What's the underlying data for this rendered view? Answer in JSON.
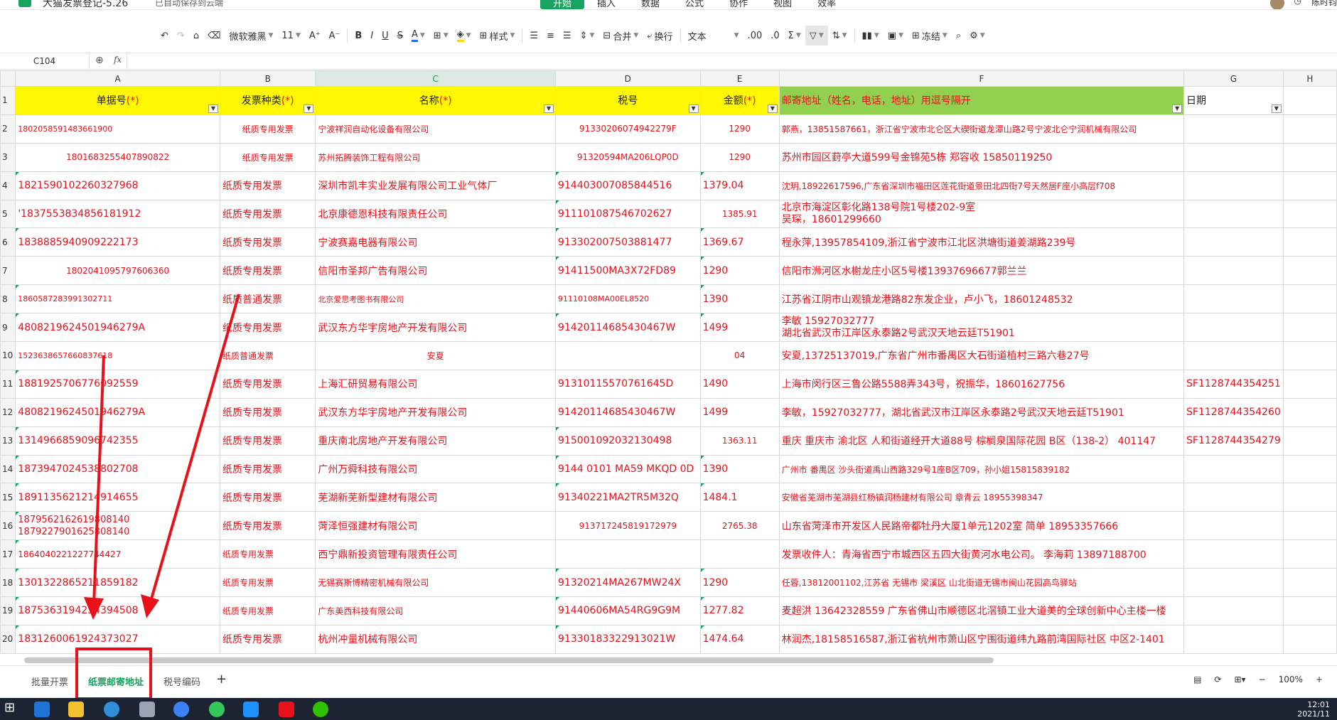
{
  "titlebar": {
    "title": "大猫发票登记-5.26",
    "saved": "已自动保存到云端",
    "menus": [
      "开始",
      "插入",
      "数据",
      "公式",
      "协作",
      "视图",
      "效率"
    ],
    "active_menu": "开始",
    "right_user": "陈时钧"
  },
  "toolbar": {
    "font": "微软雅黑",
    "size": "11",
    "style": "样式",
    "merge": "合并",
    "wrap": "换行",
    "format": "文本",
    "freeze": "冻结"
  },
  "formula_bar": {
    "cell_ref": "C104",
    "value": ""
  },
  "columns": [
    "A",
    "B",
    "C",
    "D",
    "E",
    "F",
    "G",
    "H"
  ],
  "header_row": {
    "row": "1",
    "a": "单据号",
    "b": "发票种类",
    "c": "名称",
    "d": "税号",
    "e": "金额",
    "f": "邮寄地址（姓名，电话，地址）用逗号隔开",
    "g": "日期",
    "star": "(*)"
  },
  "rows": [
    {
      "n": "2",
      "a": "1802058591483661900",
      "b": "纸质专用发票",
      "c": "宁波祥润自动化设备有限公司",
      "d": "91330206074942279F",
      "e": "1290",
      "f": "郭燕，13851587661，浙江省宁波市北仑区大碶街道龙潭山路2号宁波北仑宁润机械有限公司",
      "g": ""
    },
    {
      "n": "3",
      "a": "1801683255407890822",
      "b": "纸质专用发票",
      "c": "苏州拓腾装饰工程有限公司",
      "d": "91320594MA206LQP0D",
      "e": "1290",
      "f": "苏州市园区葑亭大道599号金锦苑5栋   郑容收 15850119250",
      "g": ""
    },
    {
      "n": "4",
      "a": "1821590102260327968",
      "b": "纸质专用发票",
      "c": "深圳市凯丰实业发展有限公司工业气体厂",
      "d": "914403007085844516",
      "e": "1379.04",
      "f": "沈玥,18922617596,广东省深圳市福田区莲花街道景田北四街7号天然居F座小高层f708",
      "g": ""
    },
    {
      "n": "5",
      "a": "'1837553834856181912",
      "b": "纸质专用发票",
      "c": "北京康德恩科技有限责任公司",
      "d": "911101087546702627",
      "e": "1385.91",
      "f": "北京市海淀区彰化路138号院1号楼202-9室",
      "f2": "吴琛，18601299660",
      "g": ""
    },
    {
      "n": "6",
      "a": "1838885940909222173",
      "b": "纸质专用发票",
      "c": "宁波赛嘉电器有限公司",
      "d": "913302007503881477",
      "e": "1369.67",
      "f": "程永萍,13957854109,浙江省宁波市江北区洪塘街道姜湖路239号",
      "g": ""
    },
    {
      "n": "7",
      "a": "1802041095797606360",
      "b": "纸质专用发票",
      "c": "信阳市圣邦广告有限公司",
      "d": "91411500MA3X72FD89",
      "e": "1290",
      "f": "信阳市浉河区水榭龙庄小区5号楼13937696677郭兰兰",
      "g": ""
    },
    {
      "n": "8",
      "a": "1860587283991302711",
      "b": "纸质普通发票",
      "c": "北京爱思考图书有限公司",
      "d": "91110108MA00EL8520",
      "e": "1390",
      "f": "江苏省江阴市山观镇龙港路82东发企业，卢小飞，18601248532",
      "g": ""
    },
    {
      "n": "9",
      "a": "4808219624501946279A",
      "b": "纸质专用发票",
      "c": "武汉东方华宇房地产开发有限公司",
      "d": "9142011468543046​7W",
      "e": "1499",
      "f": "李敏 15927032777",
      "f2": "湖北省武汉市江岸区永泰路2号武汉天地云廷T51901",
      "g": ""
    },
    {
      "n": "10",
      "a": "1523638657660837618",
      "b": "纸质普通发票",
      "c": "安夏",
      "d": "",
      "e": "04",
      "f": "安夏,13725137019,广东省广州市番禺区大石街道植村三路六巷27号",
      "g": ""
    },
    {
      "n": "11",
      "a": "1881925706776092559",
      "b": "纸质专用发票",
      "c": "上海汇研贸易有限公司",
      "d": "91310115570761645D",
      "e": "1490",
      "f": "上海市闵行区三鲁公路5588弄343号，祝振华，18601627756",
      "g": "SF1128744354251"
    },
    {
      "n": "12",
      "a": "4808219624501946279A",
      "b": "纸质专用发票",
      "c": "武汉东方华宇房地产开发有限公司",
      "d": "91420114685430467W",
      "e": "1499",
      "f": "李敏，15927032777，湖北省武汉市江岸区永泰路2号武汉天地云廷T51901",
      "g": "SF1128744354260"
    },
    {
      "n": "13",
      "a": "1314966859096742355",
      "b": "纸质专用发票",
      "c": "重庆南北房地产开发有限公司",
      "d": "915001092032130498",
      "e": "1363.11",
      "f": "重庆  重庆市  渝北区  人和街道经开大道88号 棕榈泉国际花园 B区（138-2）   401147",
      "g": "SF1128744354279"
    },
    {
      "n": "14",
      "a": "1873947024538802708",
      "b": "纸质专用发票",
      "c": "广州万舜科技有限公司",
      "d": "9144 0101 MA59 MKQD 0D",
      "e": "1390",
      "f": "广州市 番禺区 沙头街道禹山西路329号1座B区709，孙小姐15815839182",
      "g": ""
    },
    {
      "n": "15",
      "a": "1891135621214914655",
      "b": "纸质专用发票",
      "c": "芜湖新芜新型建材有限公司",
      "d": "91340221MA2TR5M32Q",
      "e": "1484.1",
      "f": "安徽省芜湖市芜湖县红杨镇润杨建材有限公司 章青云 18955398347",
      "g": ""
    },
    {
      "n": "16",
      "a": "1879562162619808140",
      "a2": "1879227901625808140",
      "b": "纸质专用发票",
      "c": "菏泽恒强建材有限公司",
      "d": "913717245819172979",
      "e": "2765.38",
      "f": "山东省菏泽市开发区人民路帝都牡丹大厦1单元1202室  简单  18953357666",
      "g": ""
    },
    {
      "n": "17",
      "a": "1864040221227744427",
      "b": "纸质专用发票",
      "c": "西宁鼎新投资管理有限责任公司",
      "d": "",
      "e": "",
      "f": "发票收件人：青海省西宁市城西区五四大街黄河水电公司。 李海莉  13897188700",
      "g": ""
    },
    {
      "n": "18",
      "a": "1301322865211859182",
      "b": "纸质专用发票",
      "c": "无锡赛斯博精密机械有限公司",
      "d": "91320214MA267MW24X",
      "e": "1290",
      "f": "任蓉,13812001102,江苏省 无锡市 梁溪区 山北街道无锡市闽山花园高鸟驿站",
      "g": ""
    },
    {
      "n": "19",
      "a": "1875363194234394508",
      "b": "纸质专用发票",
      "c": "广东美西科技有限公司",
      "d": "91440606MA54RG9G9M",
      "e": "1277.82",
      "f": "麦超洪   13642328559  广东省佛山市顺德区北滘镇工业大道美的全球创新中心主楼一楼",
      "g": ""
    },
    {
      "n": "20",
      "a": "1831260061924373027",
      "b": "纸质专用发票",
      "c": "杭州冲量机械有限公司",
      "d": "91330183322913021W",
      "e": "1474.64",
      "f": "林润杰,18158516587,浙江省杭州市萧山区宁围街道纬九路前湾国际社区 中区2-1401",
      "g": ""
    }
  ],
  "sheets": [
    "批量开票",
    "纸票邮寄地址",
    "税号编码"
  ],
  "active_sheet": "纸票邮寄地址",
  "status": {
    "zoom": "100%"
  },
  "taskbar": {
    "time": "12:01",
    "date": "2021/11"
  },
  "colors": {
    "accent": "#1aa260",
    "header_yellow": "#fff800",
    "header_green": "#92d050",
    "text_red": "#e8111a"
  }
}
